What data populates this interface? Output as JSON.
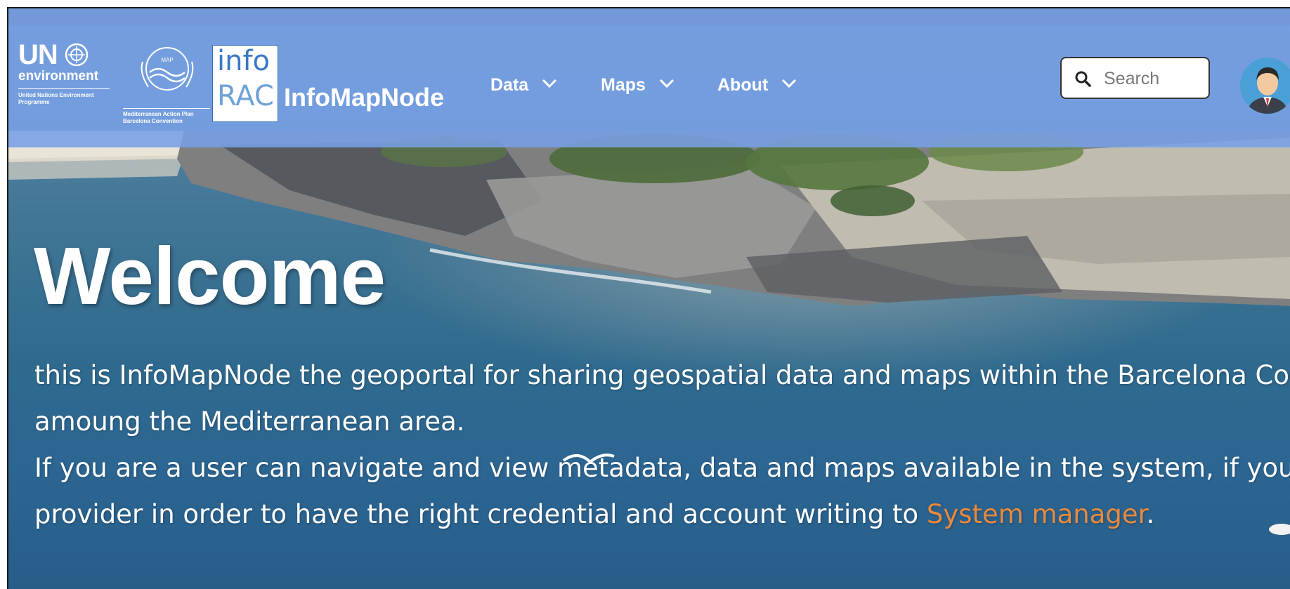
{
  "header": {
    "un_logo": {
      "title": "UN",
      "subtitle": "environment",
      "caption": "United Nations Environment Programme"
    },
    "map_logo": {
      "badge": "MAP",
      "caption": "Mediterranean Action Plan Barcelona Convention"
    },
    "info_logo": {
      "line1": "info",
      "line2": "RAC"
    },
    "brand": "InfoMapNode",
    "nav": [
      {
        "label": "Data",
        "icon": "chevron-down-icon"
      },
      {
        "label": "Maps",
        "icon": "chevron-down-icon"
      },
      {
        "label": "About",
        "icon": "chevron-down-icon"
      }
    ],
    "search": {
      "placeholder": "Search",
      "value": "",
      "icon": "search-icon"
    },
    "avatar": {
      "icon": "user-avatar-icon"
    }
  },
  "hero": {
    "title": "Welcome",
    "line1": "this is InfoMapNode the geoportal for sharing geospatial data and maps within the Barcelona Conv",
    "line2": "amoung the Mediterranean area.",
    "line3": "If you are a user can navigate and view metadata, data and maps available in the system, if you are a",
    "line4_before": "provider in order to have the right credential and account writing to ",
    "link": "System manager",
    "line4_after": "."
  },
  "colors": {
    "navbar": "#78a0e6",
    "link": "#e8893d",
    "text": "#ffffff"
  }
}
